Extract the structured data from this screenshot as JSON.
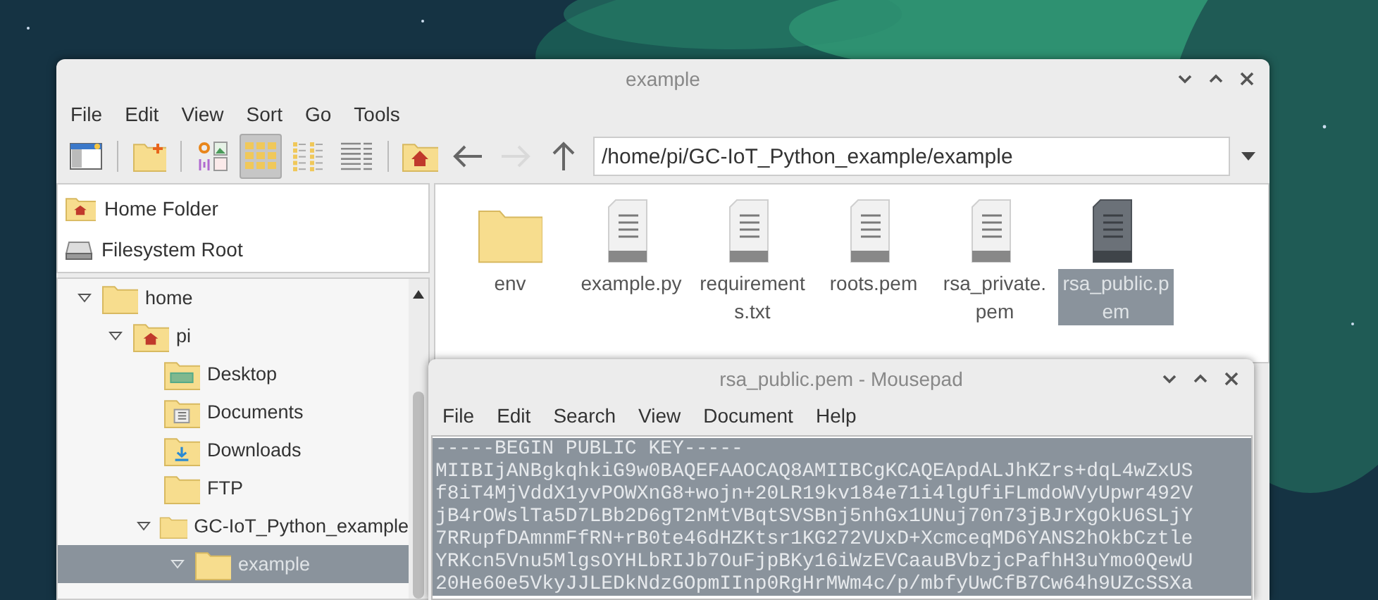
{
  "file_manager": {
    "title": "example",
    "menu": [
      "File",
      "Edit",
      "View",
      "Sort",
      "Go",
      "Tools"
    ],
    "toolbar": {
      "panel_buttons": [
        {
          "kind": "sidebar"
        },
        {
          "kind": "new-folder"
        }
      ],
      "view_buttons": [
        {
          "kind": "thumbnails",
          "selected": false
        },
        {
          "kind": "icons",
          "selected": true
        },
        {
          "kind": "compact",
          "selected": false
        },
        {
          "kind": "details",
          "selected": false
        }
      ],
      "nav_buttons": [
        {
          "kind": "home",
          "disabled": false
        },
        {
          "kind": "back",
          "disabled": false
        },
        {
          "kind": "forward",
          "disabled": true
        },
        {
          "kind": "up",
          "disabled": false
        }
      ],
      "address": {
        "value": "/home/pi/GC-IoT_Python_example/example"
      }
    },
    "places": [
      {
        "label": "Home Folder",
        "kind": "home",
        "selected": false
      },
      {
        "label": "Filesystem Root",
        "kind": "drive",
        "selected": false
      }
    ],
    "tree": [
      {
        "label": "home",
        "kind": "folder",
        "expanded": true,
        "selected": false,
        "children": [
          {
            "label": "pi",
            "kind": "home",
            "expanded": true,
            "selected": false,
            "children": [
              {
                "label": "Desktop",
                "kind": "desktop",
                "expanded": false,
                "selected": false
              },
              {
                "label": "Documents",
                "kind": "documents",
                "expanded": false,
                "selected": false
              },
              {
                "label": "Downloads",
                "kind": "downloads",
                "expanded": false,
                "selected": false
              },
              {
                "label": "FTP",
                "kind": "folder",
                "expanded": false,
                "selected": false
              },
              {
                "label": "GC-IoT_Python_example",
                "kind": "folder",
                "expanded": true,
                "selected": false,
                "children": [
                  {
                    "label": "example",
                    "kind": "folder",
                    "expanded": true,
                    "selected": true
                  }
                ]
              }
            ]
          }
        ]
      }
    ],
    "files": [
      {
        "name": "env",
        "kind": "folder",
        "selected": false
      },
      {
        "name": "example.py",
        "kind": "file",
        "selected": false
      },
      {
        "name": "requirements.txt",
        "kind": "file",
        "selected": false
      },
      {
        "name": "roots.pem",
        "kind": "file",
        "selected": false
      },
      {
        "name": "rsa_private.pem",
        "kind": "file",
        "selected": false
      },
      {
        "name": "rsa_public.pem",
        "kind": "file",
        "selected": true
      }
    ]
  },
  "editor": {
    "title": "rsa_public.pem - Mousepad",
    "menu": [
      "File",
      "Edit",
      "Search",
      "View",
      "Document",
      "Help"
    ],
    "lines": [
      {
        "text": "-----BEGIN PUBLIC KEY-----",
        "selected": true
      },
      {
        "text": "MIIBIjANBgkqhkiG9w0BAQEFAAOCAQ8AMIIBCgKCAQEApdALJhKZrs+dqL4wZxUS",
        "selected": true
      },
      {
        "text": "f8iT4MjVddX1yvPOWXnG8+wojn+20LR19kv184e71i4lgUfiFLmdoWVyUpwr492V",
        "selected": true
      },
      {
        "text": "jB4rOWslTa5D7LBb2D6gT2nMtVBqtSVSBnj5nhGx1UNuj70n73jBJrXgOkU6SLjY",
        "selected": true
      },
      {
        "text": "7RRupfDAmnmFfRN+rB0te46dHZKtsr1KG272VUxD+XcmceqMD6YANS2hOkbCztle",
        "selected": true
      },
      {
        "text": "YRKcn5Vnu5MlgsOYHLbRIJb7OuFjpBKy16iWzEVCaauBVbzjcPafhH3uYmo0QewU",
        "selected": true
      },
      {
        "text": "20He60e5VkyJJLEDkNdzGOpmIInp0RgHrMWm4c/p/mbfyUwCfB7Cw64h9UZcSSXa",
        "selected": true
      }
    ]
  }
}
